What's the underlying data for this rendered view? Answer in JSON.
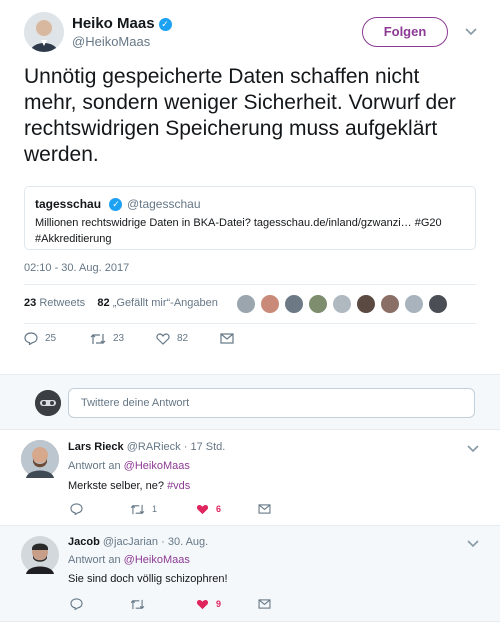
{
  "tweet": {
    "name": "Heiko Maas",
    "handle": "@HeikoMaas",
    "follow_label": "Folgen",
    "text": "Unnötig gespeicherte Daten schaffen nicht mehr, sondern weniger Sicherheit. Vorwurf der rechtswidrigen Speicherung muss aufgeklärt werden.",
    "quote": {
      "name": "tagesschau",
      "handle": "@tagesschau",
      "text_line1": "Millionen rechtswidrige Daten in BKA-Datei? tagesschau.de/inland/gzwanzi… #G20",
      "text_line2": "#Akkreditierung"
    },
    "timestamp": "02:10 - 30. Aug. 2017",
    "retweets_count": "23",
    "retweets_label": "Retweets",
    "likes_count": "82",
    "likes_label": "„Gefällt mir“-Angaben",
    "actions": {
      "reply_count": "25",
      "retweet_count": "23",
      "like_count": "82"
    },
    "liker_colors": [
      "#9aa5ad",
      "#c98a7a",
      "#6d7a86",
      "#7d8d6e",
      "#b0b8c0",
      "#5a4a42",
      "#8a6f66",
      "#a8b3bd",
      "#4b4f55"
    ]
  },
  "reply_box": {
    "placeholder": "Twittere deine Antwort"
  },
  "replies": [
    {
      "name": "Lars Rieck",
      "handle": "@RARieck",
      "time": "· 17 Std.",
      "reply_to_prefix": "Antwort an",
      "reply_to": "@HeikoMaas",
      "text": "Merkste selber, ne?",
      "hashtag": "#vds",
      "reply_count": "",
      "retweet_count": "1",
      "like_count": "6"
    },
    {
      "name": "Jacob",
      "handle": "@jacJarian",
      "time": "· 30. Aug.",
      "reply_to_prefix": "Antwort an",
      "reply_to": "@HeikoMaas",
      "text": "Sie sind doch völlig schizophren!",
      "reply_count": "",
      "retweet_count": "",
      "like_count": "9"
    }
  ],
  "icons": {
    "verified": "✓",
    "chevron": "⌄",
    "reply": "◯",
    "retweet": "⇅",
    "like": "♡",
    "like_filled": "♥",
    "message": "✉"
  },
  "colors": {
    "accent": "#8c3b94",
    "verified": "#1da1f2",
    "like_active": "#e0245e",
    "muted": "#657786"
  }
}
